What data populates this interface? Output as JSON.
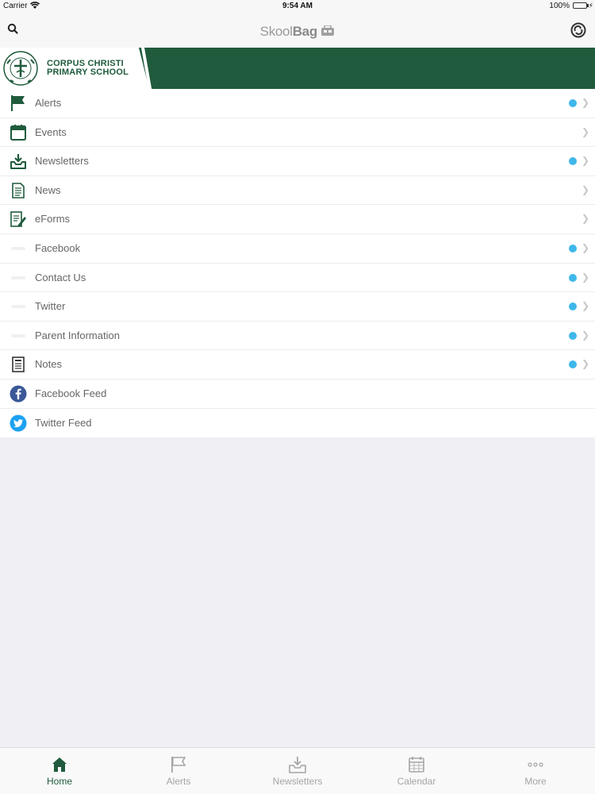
{
  "status_bar": {
    "carrier": "Carrier",
    "time": "9:54 AM",
    "battery": "100%"
  },
  "nav": {
    "logo_light": "Skool",
    "logo_bold": "Bag",
    "search_icon": "search-icon",
    "sync_icon": "sync-icon"
  },
  "banner": {
    "school_line1": "CORPUS CHRISTI",
    "school_line2": "PRIMARY SCHOOL",
    "brand_color": "#1f5b3c"
  },
  "menu": [
    {
      "label": "Alerts",
      "icon": "flag-icon",
      "dot": true,
      "chevron": true
    },
    {
      "label": "Events",
      "icon": "calendar-icon",
      "dot": false,
      "chevron": true
    },
    {
      "label": "Newsletters",
      "icon": "inbox-download-icon",
      "dot": true,
      "chevron": true
    },
    {
      "label": "News",
      "icon": "document-icon",
      "dot": false,
      "chevron": true
    },
    {
      "label": "eForms",
      "icon": "form-pen-icon",
      "dot": false,
      "chevron": true
    },
    {
      "label": "Facebook",
      "icon": "blank-icon",
      "dot": true,
      "chevron": true
    },
    {
      "label": "Contact Us",
      "icon": "blank-icon",
      "dot": true,
      "chevron": true
    },
    {
      "label": "Twitter",
      "icon": "blank-icon",
      "dot": true,
      "chevron": true
    },
    {
      "label": "Parent Information",
      "icon": "blank-icon",
      "dot": true,
      "chevron": true
    },
    {
      "label": "Notes",
      "icon": "notes-icon",
      "dot": true,
      "chevron": true
    },
    {
      "label": "Facebook Feed",
      "icon": "facebook-icon",
      "dot": false,
      "chevron": false
    },
    {
      "label": "Twitter Feed",
      "icon": "twitter-icon",
      "dot": false,
      "chevron": false
    }
  ],
  "tabs": [
    {
      "label": "Home",
      "icon": "home-icon",
      "active": true
    },
    {
      "label": "Alerts",
      "icon": "flag-icon",
      "active": false
    },
    {
      "label": "Newsletters",
      "icon": "inbox-download-icon",
      "active": false
    },
    {
      "label": "Calendar",
      "icon": "calendar-icon",
      "active": false
    },
    {
      "label": "More",
      "icon": "more-dots-icon",
      "active": false
    }
  ],
  "colors": {
    "accent_green": "#1f5b3c",
    "badge_blue": "#3fb7ea",
    "tab_inactive": "#a5a5a5"
  }
}
